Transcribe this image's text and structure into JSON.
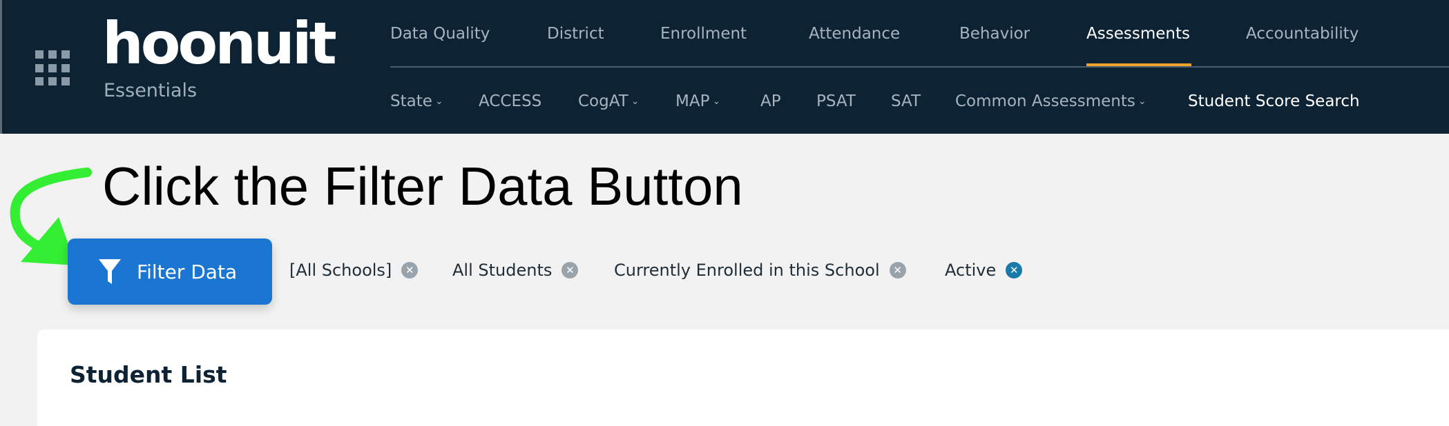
{
  "brand": {
    "logo": "hoonuit",
    "product": "Essentials"
  },
  "nav": {
    "primary": [
      {
        "label": "Data Quality",
        "active": false
      },
      {
        "label": "District",
        "active": false
      },
      {
        "label": "Enrollment",
        "active": false
      },
      {
        "label": "Attendance",
        "active": false
      },
      {
        "label": "Behavior",
        "active": false
      },
      {
        "label": "Assessments",
        "active": true
      },
      {
        "label": "Accountability",
        "active": false
      }
    ],
    "secondary": [
      {
        "label": "State",
        "dropdown": true
      },
      {
        "label": "ACCESS",
        "dropdown": false
      },
      {
        "label": "CogAT",
        "dropdown": true
      },
      {
        "label": "MAP",
        "dropdown": true
      },
      {
        "label": "AP",
        "dropdown": false
      },
      {
        "label": "PSAT",
        "dropdown": false
      },
      {
        "label": "SAT",
        "dropdown": false
      },
      {
        "label": "Common Assessments",
        "dropdown": true
      },
      {
        "label": "Student Score Search",
        "dropdown": false,
        "active": true
      }
    ],
    "accent_color": "#f0a12b"
  },
  "annotation": {
    "text": "Click the Filter Data Button",
    "arrow_color": "#33ee33"
  },
  "filter": {
    "button_label": "Filter Data",
    "button_color": "#1b76d2",
    "chips": [
      {
        "label": "[All Schools]"
      },
      {
        "label": "All Students"
      },
      {
        "label": "Currently Enrolled in this School"
      },
      {
        "label": "Active"
      }
    ],
    "remove_icon": "close-circle-icon"
  },
  "content": {
    "title": "Student List"
  }
}
